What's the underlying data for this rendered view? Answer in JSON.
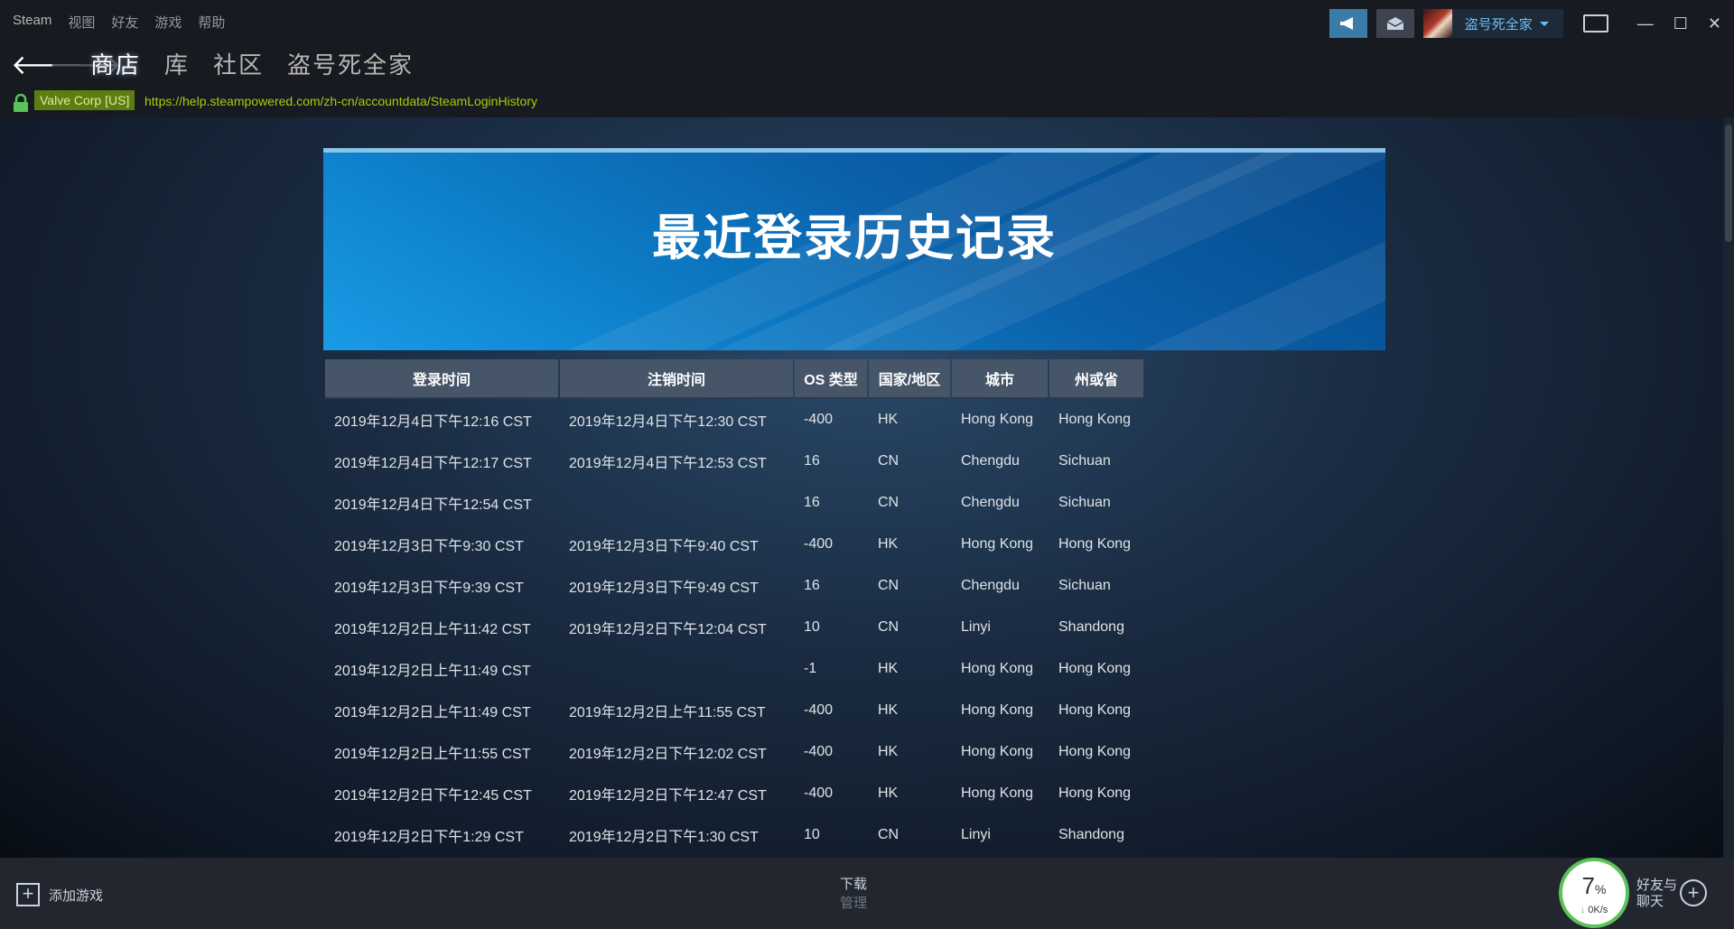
{
  "menu": {
    "items": [
      "Steam",
      "视图",
      "好友",
      "游戏",
      "帮助"
    ]
  },
  "user": {
    "name": "盗号死全家"
  },
  "nav": {
    "tabs": [
      "商店",
      "库",
      "社区",
      "盗号死全家"
    ]
  },
  "url_bar": {
    "cert": "Valve Corp [US]",
    "url": "https://help.steampowered.com/zh-cn/accountdata/SteamLoginHistory"
  },
  "banner": {
    "title": "最近登录历史记录"
  },
  "table": {
    "headers": [
      "登录时间",
      "注销时间",
      "OS 类型",
      "国家/地区",
      "城市",
      "州或省"
    ],
    "rows": [
      [
        "2019年12月4日下午12:16 CST",
        "2019年12月4日下午12:30 CST",
        "-400",
        "HK",
        "Hong Kong",
        "Hong Kong"
      ],
      [
        "2019年12月4日下午12:17 CST",
        "2019年12月4日下午12:53 CST",
        "16",
        "CN",
        "Chengdu",
        "Sichuan"
      ],
      [
        "2019年12月4日下午12:54 CST",
        "",
        "16",
        "CN",
        "Chengdu",
        "Sichuan"
      ],
      [
        "2019年12月3日下午9:30 CST",
        "2019年12月3日下午9:40 CST",
        "-400",
        "HK",
        "Hong Kong",
        "Hong Kong"
      ],
      [
        "2019年12月3日下午9:39 CST",
        "2019年12月3日下午9:49 CST",
        "16",
        "CN",
        "Chengdu",
        "Sichuan"
      ],
      [
        "2019年12月2日上午11:42 CST",
        "2019年12月2日下午12:04 CST",
        "10",
        "CN",
        "Linyi",
        "Shandong"
      ],
      [
        "2019年12月2日上午11:49 CST",
        "",
        "-1",
        "HK",
        "Hong Kong",
        "Hong Kong"
      ],
      [
        "2019年12月2日上午11:49 CST",
        "2019年12月2日上午11:55 CST",
        "-400",
        "HK",
        "Hong Kong",
        "Hong Kong"
      ],
      [
        "2019年12月2日上午11:55 CST",
        "2019年12月2日下午12:02 CST",
        "-400",
        "HK",
        "Hong Kong",
        "Hong Kong"
      ],
      [
        "2019年12月2日下午12:45 CST",
        "2019年12月2日下午12:47 CST",
        "-400",
        "HK",
        "Hong Kong",
        "Hong Kong"
      ],
      [
        "2019年12月2日下午1:29 CST",
        "2019年12月2日下午1:30 CST",
        "10",
        "CN",
        "Linyi",
        "Shandong"
      ]
    ]
  },
  "bottom": {
    "add_game": "添加游戏",
    "downloads_title": "下载",
    "downloads_sub": "管理",
    "progress_percent": "7",
    "progress_unit": "%",
    "speed": "0K/s",
    "friends_line1": "好友与",
    "friends_line2": "聊天"
  },
  "colors": {
    "accent": "#66c0f4",
    "url_green": "#a4d007",
    "cert_bg": "#5c7e10",
    "progress_green": "#5ac35a"
  }
}
